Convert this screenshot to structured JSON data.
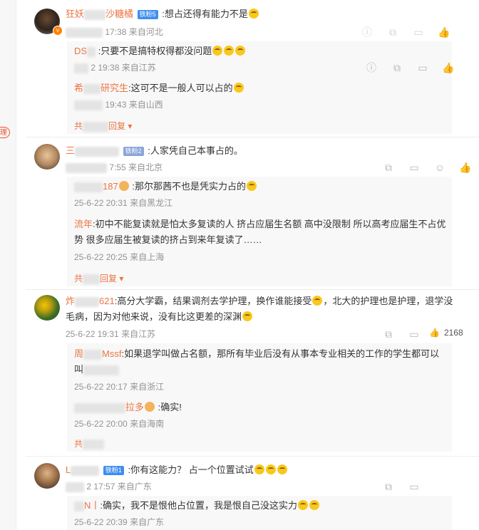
{
  "comments": [
    {
      "user_name": "狂妖",
      "user_name_tail": "沙糖橘",
      "level": "铁粉5",
      "text": ":想占还得有能力不是",
      "time": "17:38",
      "location": "来自河北",
      "replies": [
        {
          "user": "DS",
          "text": ":只要不是搞特权得都没问题",
          "time": "2 19:38",
          "location": "来自江苏"
        },
        {
          "user": "希",
          "user_tail": "研究生",
          "text": ":这可不是一般人可以占的",
          "time": "19:43",
          "location": "来自山西"
        }
      ],
      "more_label": "共",
      "more_tail": "回复"
    },
    {
      "user_name": "三",
      "level": "铁粉2",
      "text": ":人家凭自己本事占的。",
      "time": "7:55",
      "location": "来自北京",
      "replies": [
        {
          "user": "",
          "user_tail": "187",
          "text": ":那尔那茜不也是凭实力占的",
          "time": "25-6-22 20:31",
          "location": "来自黑龙江"
        },
        {
          "user": "流年",
          "text": ":初中不能复读就是怕太多复读的人  挤占应届生名额 高中没限制 所以高考应届生不占优势 很多应届生被复读的挤占到来年复读了……",
          "text_line1": ":初中不能复读就是怕太多复读的人  挤占应届生名额 高中没限制 所以高考应届生不占优",
          "text_line2": "势 很多应届生被复读的挤占到来年复读了……",
          "time": "25-6-22 20:25",
          "location": "来自上海"
        }
      ],
      "more_label": "共",
      "more_tail": "回复"
    },
    {
      "user_name": "炸",
      "user_name_tail": "621",
      "text_line1": ":高分大学霸，结果调剂去学护理，换作谁能接受",
      "text_line1b": "，北大的护理也是护理，退学没",
      "text_line2": "毛病，因为对他来说，没有比这更差的深渊",
      "time": "25-6-22 19:31",
      "location": "来自江苏",
      "likes": "2168",
      "replies": [
        {
          "user": "周",
          "user_tail": "Mssf",
          "text_line1": ":如果退学叫做占名额，那所有毕业后没有从事本专业相关的工作的学生都可以",
          "text_line2": "叫",
          "time": "25-6-22 20:17",
          "location": "来自浙江"
        },
        {
          "user": "",
          "user_tail": "拉多",
          "text": ":确实!",
          "time": "25-6-22 20:00",
          "location": "来自海南"
        }
      ],
      "more_label": "共"
    },
    {
      "user_name": "L",
      "level": "铁粉1",
      "text": ":你有这能力？ 占一个位置试试",
      "time": "2 17:57",
      "location": "来自广东",
      "replies": [
        {
          "user": "N丨",
          "text": ":确实，我不是恨他占位置，我是恨自己没这实力",
          "time": "25-6-22 20:39",
          "location": "来自广东"
        }
      ]
    }
  ],
  "leftstrip": {
    "tag": "理"
  }
}
